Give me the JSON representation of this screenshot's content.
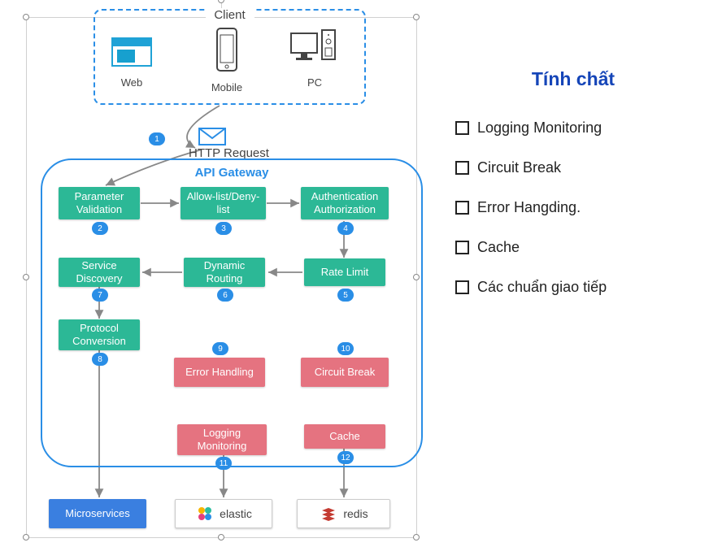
{
  "client": {
    "label": "Client",
    "web": "Web",
    "mobile": "Mobile",
    "pc": "PC"
  },
  "http_request": "HTTP Request",
  "gateway_label": "API Gateway",
  "nodes": {
    "param": "Parameter Validation",
    "allow": "Allow-list/Deny-list",
    "auth": "Authentication Authorization",
    "rate": "Rate Limit",
    "route": "Dynamic Routing",
    "disc": "Service Discovery",
    "proto": "Protocol Conversion",
    "err": "Error Handling",
    "circ": "Circuit Break",
    "log": "Logging Monitoring",
    "cache": "Cache"
  },
  "external": {
    "microservices": "Microservices",
    "elastic": "elastic",
    "redis": "redis"
  },
  "steps": {
    "s1": "1",
    "s2": "2",
    "s3": "3",
    "s4": "4",
    "s5": "5",
    "s6": "6",
    "s7": "7",
    "s8": "8",
    "s9": "9",
    "s10": "10",
    "s11": "11",
    "s12": "12"
  },
  "sidebar": {
    "title": "Tính chất",
    "items": [
      "Logging Monitoring",
      "Circuit Break",
      "Error Hangding.",
      "Cache",
      "Các chuẩn giao tiếp"
    ]
  }
}
